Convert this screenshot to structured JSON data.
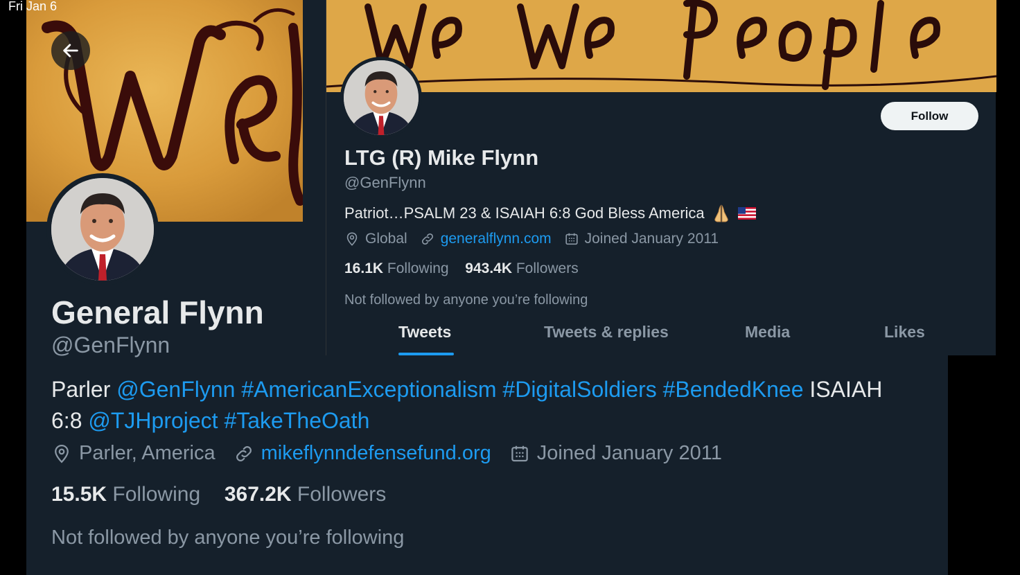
{
  "status_bar": {
    "time": "Fri Jan 6"
  },
  "profile_a": {
    "banner_script": "We",
    "name": "General Flynn",
    "handle": "@GenFlynn",
    "bio": {
      "line1_prefix": "Parler ",
      "line1_links": "@GenFlynn #AmericanExceptionalism #DigitalSoldiers #BendedKnee",
      "line1_suffix": " ISAIAH",
      "line2_prefix": "6:8 ",
      "line2_links": "@TJHproject #TakeTheOath"
    },
    "location": "Parler, America",
    "url": "mikeflynndefensefund.org",
    "joined": "Joined January 2011",
    "following_count": "15.5K",
    "following_label": "Following",
    "followers_count": "367.2K",
    "followers_label": "Followers",
    "not_followed": "Not followed by anyone you’re following"
  },
  "profile_b": {
    "banner_script": "We the People",
    "follow_button": "Follow",
    "name": "LTG (R) Mike Flynn",
    "handle": "@GenFlynn",
    "bio": "Patriot…PSALM 23 & ISAIAH 6:8 God Bless America",
    "location": "Global",
    "url": "generalflynn.com",
    "joined": "Joined January 2011",
    "following_count": "16.1K",
    "following_label": "Following",
    "followers_count": "943.4K",
    "followers_label": "Followers",
    "not_followed": "Not followed by anyone you’re following",
    "tabs": [
      {
        "label": "Tweets",
        "active": true
      },
      {
        "label": "Tweets & replies",
        "active": false
      },
      {
        "label": "Media",
        "active": false
      },
      {
        "label": "Likes",
        "active": false
      }
    ]
  },
  "icons": {
    "back": "arrow-left-icon",
    "location": "location-pin-icon",
    "link": "link-icon",
    "calendar": "calendar-icon",
    "emoji_1": "praying-hands-emoji",
    "emoji_2": "us-flag-emoji"
  },
  "colors": {
    "background": "#15202b",
    "accent": "#1d9bf0",
    "muted": "#8b98a5",
    "text": "#e7e9ea"
  }
}
